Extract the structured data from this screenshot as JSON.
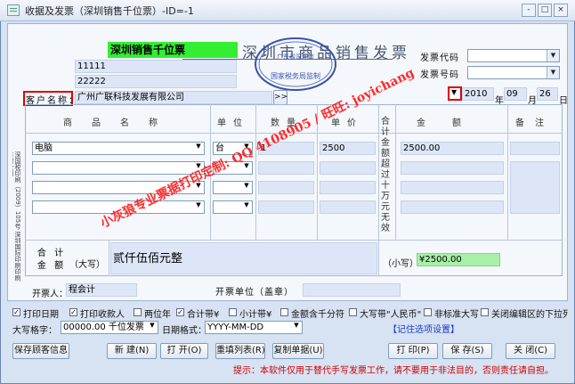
{
  "window": {
    "title": "收据及发票（深圳销售千位票）-ID=-1",
    "minimize": "-",
    "maximize": "□",
    "close": "×"
  },
  "invoice": {
    "type_badge": "深圳销售千位票",
    "heading": "深圳市商品销售发票",
    "seal_top": "广东省深圳市",
    "seal_bottom": "国家税务局监制",
    "code_label": "发票代码",
    "number_label": "发票号码",
    "field1": "11111",
    "field2": "22222",
    "customer_label": "客户名称：",
    "customer_value": "广州广联科技发展有限公司",
    "customer_btn": ">>",
    "year": "2010",
    "year_unit": "年",
    "month": "09",
    "month_unit": "月",
    "day": "26",
    "day_unit": "日",
    "side_text": "深国税印刷（2009）105号 深圳国际印刷印刷有限公司"
  },
  "table": {
    "col_name": "商品名称",
    "col_unit": "单位",
    "col_qty": "数量",
    "col_price": "单价",
    "col_total_sum": "合计金额超过十万元无效",
    "col_amount": "金额",
    "col_note": "备注",
    "rows": [
      {
        "name": "电脑",
        "unit": "台",
        "qty": "1",
        "price": "2500",
        "amount": "2500.00"
      },
      {
        "name": "",
        "unit": "",
        "qty": "",
        "price": "",
        "amount": ""
      },
      {
        "name": "",
        "unit": "",
        "qty": "",
        "price": "",
        "amount": ""
      },
      {
        "name": "",
        "unit": "",
        "qty": "",
        "price": "",
        "amount": ""
      }
    ],
    "total_label": "合 计金 额",
    "daxie_label": "（大写）",
    "daxie_value": "贰仟伍佰元整",
    "xiaoxie_label": "（小写）",
    "xiaoxie_value": "¥2500.00"
  },
  "footer": {
    "issuer_label": "开票人：",
    "issuer_value": "程会计",
    "unit_label": "开票单位（盖章）"
  },
  "watermark": {
    "line1": "小灰狼专业票据打印定制: QQ 4108905 / 旺旺: joyichang"
  },
  "options": [
    {
      "label": "打印日期",
      "checked": true
    },
    {
      "label": "打印收款人",
      "checked": true
    },
    {
      "label": "两位年",
      "checked": false
    },
    {
      "label": "合计带¥",
      "checked": true
    },
    {
      "label": "小计带¥",
      "checked": false
    },
    {
      "label": "金额含千分符",
      "checked": false
    },
    {
      "label": "大写带\"人民币\"",
      "checked": false
    },
    {
      "label": "非标准大写",
      "checked": false
    },
    {
      "label": "关闭编辑区的下拉列",
      "checked": false
    }
  ],
  "settings": {
    "daxie_prefix_label": "大写格字：",
    "daxie_prefix_value": "00000.00 千位发票",
    "date_format_label": "日期格式：",
    "date_format_value": "YYYY-MM-DD",
    "remember_link": "【记住选项设置】"
  },
  "buttons": {
    "save_info": "保存顾客信息",
    "new": "新  建(N)",
    "open": "打  开(O)",
    "refill": "重填列表(R)",
    "copy": "复制单据(U)",
    "print": "打  印(P)",
    "save": "保  存(S)",
    "close": "关  闭(C)"
  },
  "hint": "提示：本软件仅用于替代手写发票工作，请不要用于非法目的，否则责任请自担。",
  "colors": {
    "badge_green": "#33ee33",
    "red_border": "#e00000",
    "watermark_red": "#ff2020",
    "seal_blue": "#3a52a8",
    "hint_red": "#d00000"
  }
}
